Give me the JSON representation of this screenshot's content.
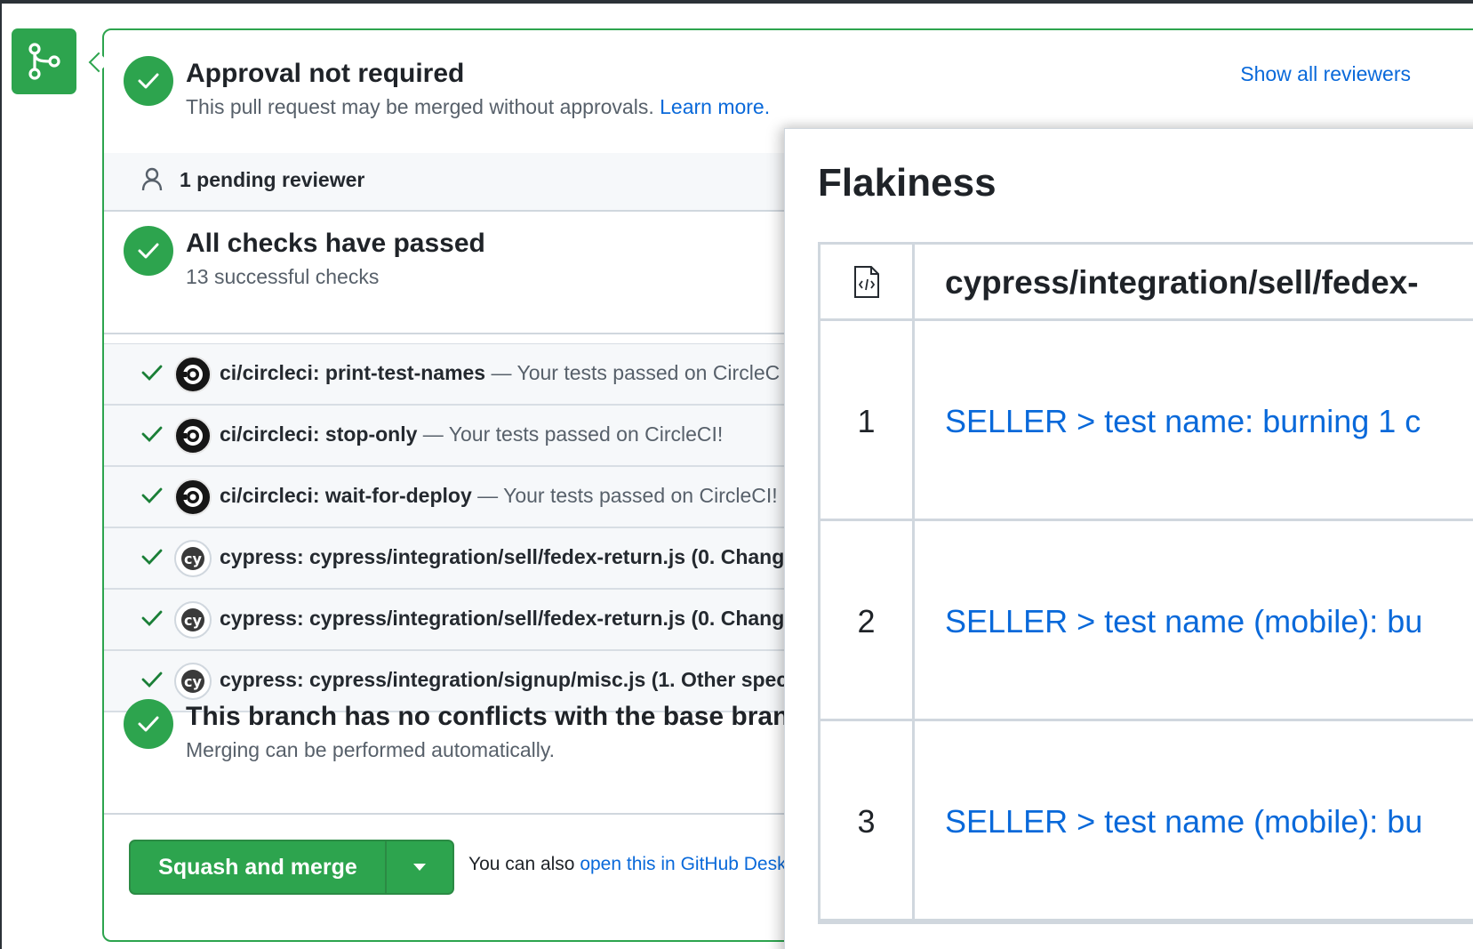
{
  "approval": {
    "title": "Approval not required",
    "subtitle": "This pull request may be merged without approvals.",
    "learn_more": "Learn more.",
    "show_reviewers": "Show all reviewers"
  },
  "pending": {
    "label": "1 pending reviewer"
  },
  "checks": {
    "title": "All checks have passed",
    "subtitle": "13 successful checks",
    "items": [
      {
        "logo": "circleci-logo-icon",
        "name": "ci/circleci: print-test-names",
        "desc": " — Your tests passed on CircleC"
      },
      {
        "logo": "circleci-logo-icon",
        "name": "ci/circleci: stop-only",
        "desc": " — Your tests passed on CircleCI!"
      },
      {
        "logo": "circleci-logo-icon",
        "name": "ci/circleci: wait-for-deploy",
        "desc": " — Your tests passed on CircleCI!"
      },
      {
        "logo": "cypress-logo-icon",
        "name": "cypress: cypress/integration/sell/fedex-return.js (0. Chang",
        "desc": ""
      },
      {
        "logo": "cypress-logo-icon",
        "name": "cypress: cypress/integration/sell/fedex-return.js (0. Chang",
        "desc": ""
      },
      {
        "logo": "cypress-logo-icon",
        "name": "cypress: cypress/integration/signup/misc.js (1. Other spec",
        "desc": ""
      }
    ]
  },
  "conflicts": {
    "title": "This branch has no conflicts with the base branch",
    "subtitle": "Merging can be performed automatically."
  },
  "merge": {
    "button_label": "Squash and merge",
    "alt_prefix": "You can also ",
    "alt_link": "open this in GitHub Deskt"
  },
  "flakiness": {
    "title": "Flakiness",
    "file": "cypress/integration/sell/fedex-",
    "rows": [
      {
        "num": "1",
        "test": "SELLER > test name: burning 1 c"
      },
      {
        "num": "2",
        "test": "SELLER > test name (mobile): bu"
      },
      {
        "num": "3",
        "test": "SELLER > test name (mobile): bu"
      }
    ]
  },
  "colors": {
    "success": "#2da44e",
    "link": "#0969da",
    "circleci_logo": "#161616"
  }
}
